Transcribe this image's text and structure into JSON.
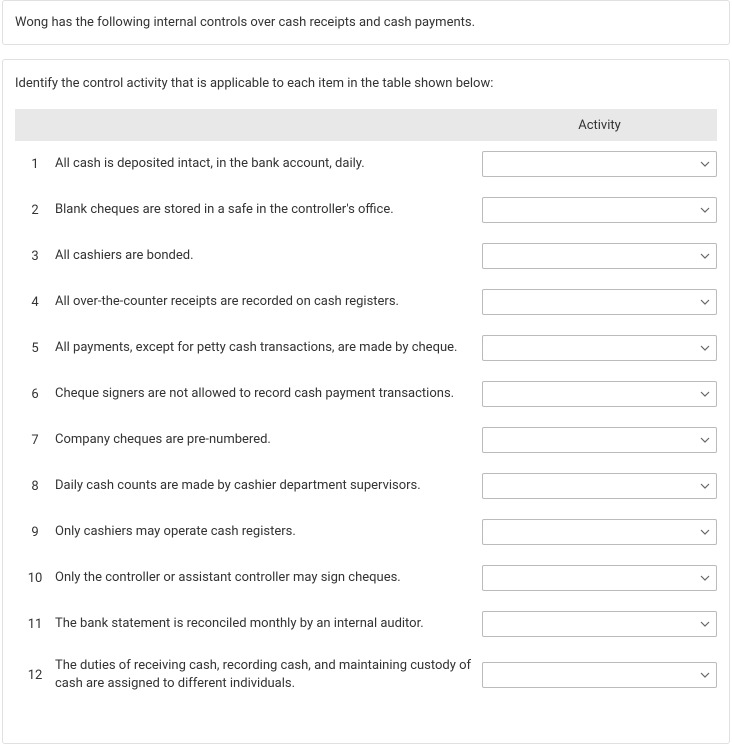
{
  "intro": "Wong has the following internal controls over cash receipts and cash payments.",
  "instruction": "Identify the control activity that is applicable to each item in the table shown below:",
  "header": {
    "activity": "Activity"
  },
  "rows": [
    {
      "num": "1",
      "desc": "All cash is deposited intact, in the bank account, daily."
    },
    {
      "num": "2",
      "desc": "Blank cheques are stored in a safe in the controller's office."
    },
    {
      "num": "3",
      "desc": "All cashiers are bonded."
    },
    {
      "num": "4",
      "desc": "All over-the-counter receipts are recorded on cash registers."
    },
    {
      "num": "5",
      "desc": "All payments, except for petty cash transactions, are made by cheque."
    },
    {
      "num": "6",
      "desc": "Cheque signers are not allowed to record cash payment transactions."
    },
    {
      "num": "7",
      "desc": "Company cheques are pre-numbered."
    },
    {
      "num": "8",
      "desc": "Daily cash counts are made by cashier department supervisors."
    },
    {
      "num": "9",
      "desc": "Only cashiers may operate cash registers."
    },
    {
      "num": "10",
      "desc": "Only the controller or assistant controller may sign cheques."
    },
    {
      "num": "11",
      "desc": "The bank statement is reconciled monthly by an internal auditor."
    },
    {
      "num": "12",
      "desc": "The duties of receiving cash, recording cash, and maintaining custody of cash are assigned to different individuals."
    }
  ]
}
